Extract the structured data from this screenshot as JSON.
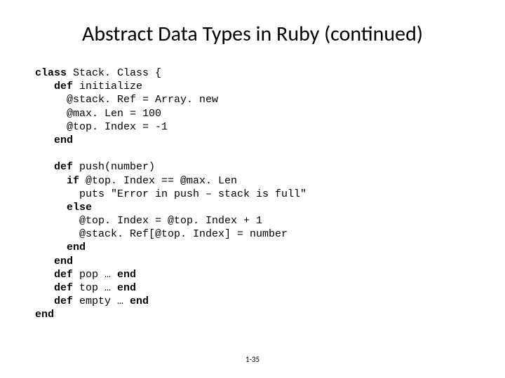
{
  "title": "Abstract Data Types in Ruby (continued)",
  "code": {
    "l1a": "class",
    "l1b": " Stack. Class {",
    "l2a": "   def",
    "l2b": " initialize",
    "l3": "     @stack. Ref = Array. new",
    "l4": "     @max. Len = 100",
    "l5": "     @top. Index = -1",
    "l6a": "   end",
    "l7": "",
    "l8a": "   def",
    "l8b": " push(number)",
    "l9a": "     if",
    "l9b": " @top. Index == @max. Len",
    "l10": "       puts \"Error in push – stack is full\"",
    "l11a": "     else",
    "l12": "       @top. Index = @top. Index + 1",
    "l13": "       @stack. Ref[@top. Index] = number",
    "l14a": "     end",
    "l15a": "   end",
    "l16a": "   def",
    "l16b": " pop … ",
    "l16c": "end",
    "l17a": "   def",
    "l17b": " top … ",
    "l17c": "end",
    "l18a": "   def",
    "l18b": " empty … ",
    "l18c": "end",
    "l19a": "end"
  },
  "page_number": "1-35"
}
